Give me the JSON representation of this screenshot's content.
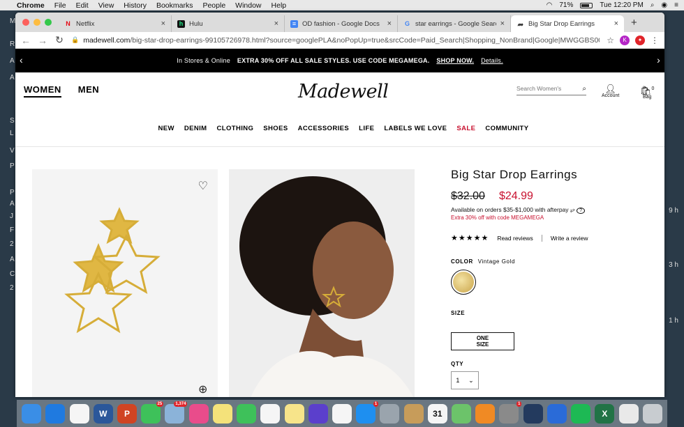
{
  "menubar": {
    "items": [
      "Chrome",
      "File",
      "Edit",
      "View",
      "History",
      "Bookmarks",
      "People",
      "Window",
      "Help"
    ],
    "battery": "71%",
    "clock": "Tue 12:20 PM"
  },
  "browser": {
    "tabs": [
      {
        "title": "Netflix",
        "favicon": "N",
        "fav_color": "#e50914"
      },
      {
        "title": "Hulu",
        "favicon": "h",
        "fav_color": "#1ce783"
      },
      {
        "title": "OD fashion - Google Docs",
        "favicon": "≡",
        "fav_color": "#4285f4"
      },
      {
        "title": "star earrings - Google Search",
        "favicon": "G",
        "fav_color": "#4285f4"
      },
      {
        "title": "Big Star Drop Earrings",
        "favicon": "𝓂",
        "fav_color": "#111111"
      }
    ],
    "url_host": "madewell.com",
    "url_rest": "/big-star-drop-earrings-99105726978.html?source=googlePLA&noPopUp=true&srcCode=Paid_Search|Shopping_NonBrand|Google|MWGGBS00002_9...",
    "profile_initial": "K"
  },
  "promo": {
    "lead": "In Stores & Online",
    "headline": "EXTRA 30% OFF ALL SALE STYLES. USE CODE MEGAMEGA.",
    "shop_now": "SHOP NOW.",
    "details": "Details."
  },
  "header": {
    "women": "WOMEN",
    "men": "MEN",
    "logo": "Madewell",
    "search_placeholder": "Search Women's",
    "account": "Account",
    "bag": "Bag",
    "bag_count": "0"
  },
  "nav": [
    "NEW",
    "DENIM",
    "CLOTHING",
    "SHOES",
    "ACCESSORIES",
    "LIFE",
    "LABELS WE LOVE",
    "SALE",
    "COMMUNITY"
  ],
  "product": {
    "title": "Big Star Drop Earrings",
    "old_price": "$32.00",
    "new_price": "$24.99",
    "afterpay": "Available on orders $35-$1,000 with afterpay",
    "promo_line": "Extra 30% off with code MEGAMEGA",
    "stars": "★★★★★",
    "read_reviews": "Read reviews",
    "write_review": "Write a review",
    "color_label": "COLOR",
    "color_value": "Vintage Gold",
    "size_label": "SIZE",
    "size_value": "ONE SIZE",
    "qty_label": "QTY",
    "qty_value": "1"
  },
  "desktop_left": [
    "M",
    "R",
    "A",
    "A",
    "S",
    "L",
    "V",
    "P",
    "P",
    "A",
    "J",
    "F",
    "2",
    "A",
    "C",
    "2"
  ],
  "desktop_right": [
    "9 h",
    "3 h",
    "1 h"
  ],
  "dock": [
    {
      "name": "finder",
      "color": "#3a8ee6"
    },
    {
      "name": "safari",
      "color": "#1f7ae0"
    },
    {
      "name": "chrome",
      "color": "#f5f5f5"
    },
    {
      "name": "word",
      "color": "#2b579a",
      "label": "W"
    },
    {
      "name": "powerpoint",
      "color": "#d04423",
      "label": "P"
    },
    {
      "name": "messages",
      "color": "#3ec15a",
      "badge": "25"
    },
    {
      "name": "preview",
      "color": "#8bb3d9",
      "badge": "1,374"
    },
    {
      "name": "itunes",
      "color": "#e94c8b"
    },
    {
      "name": "stickies",
      "color": "#f4e27a"
    },
    {
      "name": "facetime",
      "color": "#3ec15a"
    },
    {
      "name": "photos",
      "color": "#f5f5f5"
    },
    {
      "name": "notes",
      "color": "#f7e48a"
    },
    {
      "name": "siri",
      "color": "#5b3fcc"
    },
    {
      "name": "reminders",
      "color": "#f5f5f5"
    },
    {
      "name": "appstore",
      "color": "#1e8ff0",
      "badge": "1"
    },
    {
      "name": "launchpad",
      "color": "#9aa4ad"
    },
    {
      "name": "contacts",
      "color": "#c79c5a"
    },
    {
      "name": "calendar",
      "color": "#f5f5f5",
      "label": "31"
    },
    {
      "name": "maps",
      "color": "#6cc36a"
    },
    {
      "name": "books",
      "color": "#f08a24"
    },
    {
      "name": "system-preferences",
      "color": "#8a8a8a",
      "badge": "1"
    },
    {
      "name": "quicktime",
      "color": "#233a5e"
    },
    {
      "name": "bluetooth",
      "color": "#2a6bd8"
    },
    {
      "name": "spotify",
      "color": "#1db954"
    },
    {
      "name": "excel",
      "color": "#217346",
      "label": "X"
    },
    {
      "name": "documents",
      "color": "#e9e9e9"
    },
    {
      "name": "trash",
      "color": "#c8ccd0"
    }
  ]
}
